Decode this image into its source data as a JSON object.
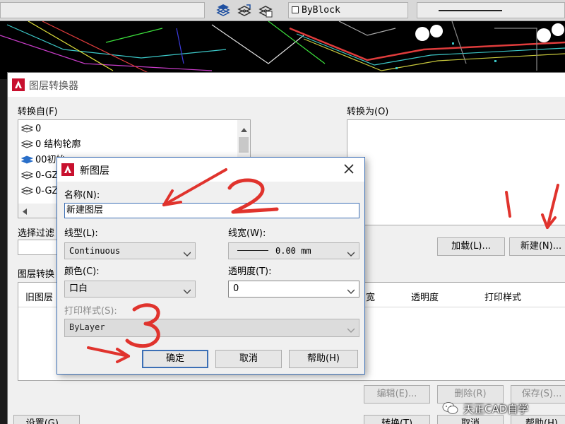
{
  "toolbar": {
    "linetype_value": "ByBlock"
  },
  "main_dialog": {
    "title": "图层转换器",
    "convert_from_label": "转换自(F)",
    "convert_from_layers": [
      {
        "name": "0"
      },
      {
        "name": "0 结构轮廓"
      },
      {
        "name": "00初始"
      },
      {
        "name": "0-GZ"
      },
      {
        "name": "0-GZ"
      }
    ],
    "convert_to_label": "转换为(O)",
    "selection_filter_label": "选择过滤",
    "load_button": "加载(L)...",
    "new_button": "新建(N)...",
    "mapping_label": "图层转换",
    "mapping_columns": [
      "旧图层",
      "宽",
      "透明度",
      "打印样式"
    ],
    "edit_button": "编辑(E)...",
    "delete_button": "删除(R)",
    "save_button": "保存(S)...",
    "settings_button": "设置(G)...",
    "convert_button": "转换(T)",
    "cancel_button": "取消",
    "help_button": "帮助(H)"
  },
  "new_layer_dialog": {
    "title": "新图层",
    "name_label": "名称(N):",
    "name_value": "新建图层",
    "linetype_label": "线型(L):",
    "linetype_value": "Continuous",
    "lineweight_label": "线宽(W):",
    "lineweight_value": "0.00 mm",
    "color_label": "颜色(C):",
    "color_value": "口白",
    "transparency_label": "透明度(T):",
    "transparency_value": "0",
    "plotstyle_label": "打印样式(S):",
    "plotstyle_value": "ByLayer",
    "ok_button": "确定",
    "cancel_button": "取消",
    "help_button": "帮助(H)"
  },
  "annotations": {
    "step1": "1",
    "step2": "2",
    "step3": "3",
    "color": "#e0332d"
  },
  "watermark": {
    "text": "天正CAD自学"
  },
  "colors": {
    "autocad_red": "#c8102e",
    "dialog_bg": "#f0f0f0",
    "focus_blue": "#3c6fb5"
  }
}
